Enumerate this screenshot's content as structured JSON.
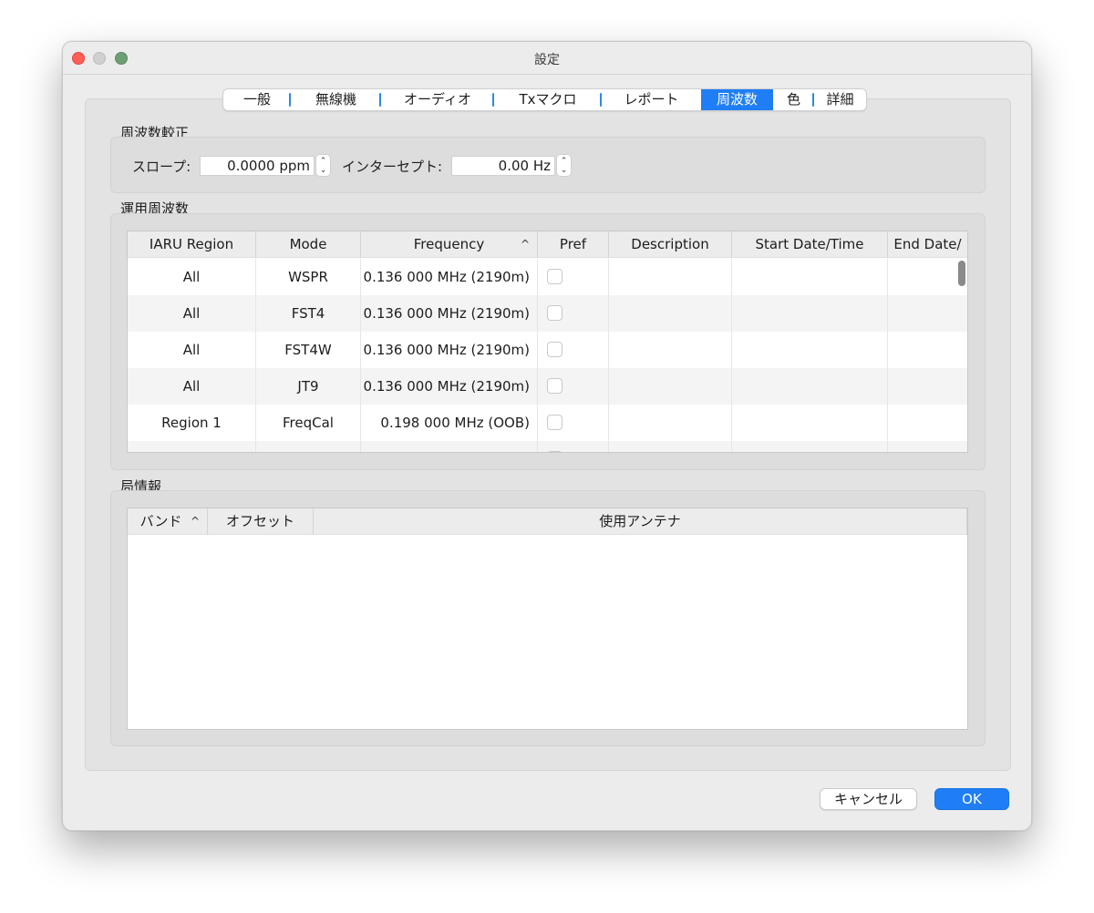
{
  "window": {
    "title": "設定"
  },
  "tabs": [
    {
      "label": "一般"
    },
    {
      "label": "無線機"
    },
    {
      "label": "オーディオ"
    },
    {
      "label": "Txマクロ"
    },
    {
      "label": "レポート"
    },
    {
      "label": "周波数",
      "active": true
    },
    {
      "label": "色"
    },
    {
      "label": "詳細"
    }
  ],
  "calibration": {
    "title": "周波数較正",
    "slope_label": "スロープ:",
    "slope_value": "0.0000 ppm",
    "intercept_label": "インターセプト:",
    "intercept_value": "0.00 Hz"
  },
  "working_frequencies": {
    "title": "運用周波数",
    "columns": [
      "IARU Region",
      "Mode",
      "Frequency",
      "Pref",
      "Description",
      "Start Date/Time",
      "End Date/"
    ],
    "sort_indicator": "^",
    "rows": [
      {
        "region": "All",
        "mode": "WSPR",
        "frequency": "0.136 000 MHz (2190m)",
        "pref": false,
        "description": "",
        "start": "",
        "end": ""
      },
      {
        "region": "All",
        "mode": "FST4",
        "frequency": "0.136 000 MHz (2190m)",
        "pref": false,
        "description": "",
        "start": "",
        "end": ""
      },
      {
        "region": "All",
        "mode": "FST4W",
        "frequency": "0.136 000 MHz (2190m)",
        "pref": false,
        "description": "",
        "start": "",
        "end": ""
      },
      {
        "region": "All",
        "mode": "JT9",
        "frequency": "0.136 000 MHz (2190m)",
        "pref": false,
        "description": "",
        "start": "",
        "end": ""
      },
      {
        "region": "Region 1",
        "mode": "FreqCal",
        "frequency": "0.198 000 MHz (OOB)",
        "pref": false,
        "description": "",
        "start": "",
        "end": ""
      }
    ]
  },
  "station_info": {
    "title": "局情報",
    "columns": [
      "バンド",
      "オフセット",
      "使用アンテナ"
    ],
    "sort_indicator": "^"
  },
  "buttons": {
    "cancel": "キャンセル",
    "ok": "OK"
  },
  "colors": {
    "accent": "#1f7ef5",
    "close": "#fe5f57"
  }
}
